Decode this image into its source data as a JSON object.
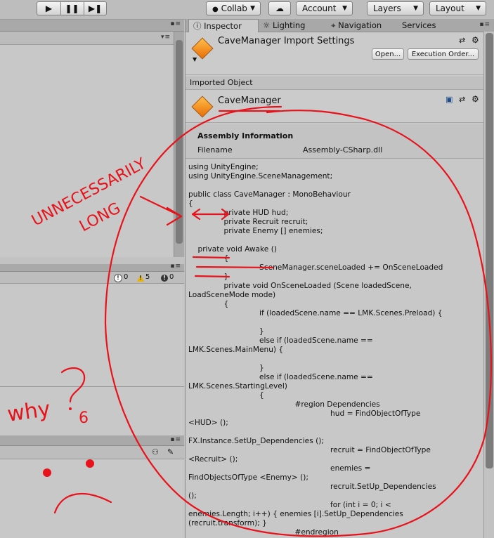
{
  "toolbar": {
    "collab_label": "Collab",
    "account_label": "Account",
    "layers_label": "Layers",
    "layout_label": "Layout"
  },
  "console": {
    "log_count": "0",
    "warn_count": "5",
    "error_count": "0"
  },
  "inspector": {
    "tabs": [
      "Inspector",
      "Lighting",
      "Navigation",
      "Services"
    ],
    "header_title": "CaveManager Import Settings",
    "open_label": "Open...",
    "execution_order_label": "Execution Order...",
    "imported_object_label": "Imported Object",
    "object_name": "CaveManager",
    "assembly_info_label": "Assembly Information",
    "filename_label": "Filename",
    "filename_value": "Assembly-CSharp.dll",
    "code_lines": [
      "using UnityEngine;",
      "using UnityEngine.SceneManagement;",
      "",
      "public class CaveManager : MonoBehaviour",
      "{",
      "               private HUD hud;",
      "               private Recruit recruit;",
      "               private Enemy [] enemies;",
      "",
      "    private void Awake ()",
      "               {",
      "                              SceneManager.sceneLoaded += OnSceneLoaded",
      "               }",
      "               private void OnSceneLoaded (Scene loadedScene,",
      "LoadSceneMode mode)",
      "               {",
      "                              if (loadedScene.name == LMK.Scenes.Preload) {",
      "",
      "                              }",
      "                              else if (loadedScene.name ==",
      "LMK.Scenes.MainMenu) {",
      "",
      "                              }",
      "                              else if (loadedScene.name ==",
      "LMK.Scenes.StartingLevel)",
      "                              {",
      "                                             #region Dependencies",
      "                                                            hud = FindObjectOfType",
      "<HUD> ();",
      "",
      "FX.Instance.SetUp_Dependencies ();",
      "                                                            recruit = FindObjectOfType",
      "<Recruit> ();",
      "                                                            enemies =",
      "FindObjectsOfType <Enemy> ();",
      "                                                            recruit.SetUp_Dependencies",
      "();",
      "                                                            for (int i = 0; i <",
      "enemies.Length; i++) { enemies [i].SetUp_Dependencies",
      "(recruit.transform); }",
      "                                             #endregion"
    ]
  },
  "annotations": {
    "unnecessarily": "UNNECESSARILY",
    "long": "LONG",
    "why": "why",
    "six": "6"
  },
  "colors": {
    "ink": "#e8121b",
    "asset_orange": "#f28a1a"
  }
}
